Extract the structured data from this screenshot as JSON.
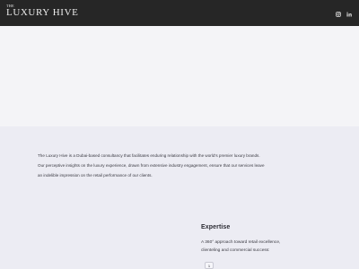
{
  "header": {
    "logo_the": "THE",
    "logo_main": "Luxury Hive",
    "social": [
      {
        "icon": "instagram-icon"
      },
      {
        "icon": "linkedin-icon"
      }
    ]
  },
  "intro": {
    "line1": "The Luxury Hive is a Dubai-based consultancy that facilitates enduring relationship with the world’s premier luxury brands.",
    "line2": "Our perceptive insights on the luxury experience, drawn from extensive industry engagement, ensure that our services leave",
    "line3": "an indelible impression on the retail performance of our clients."
  },
  "expertise": {
    "title": "Expertise",
    "desc_line1": "A 360° approach toward retail excellence,",
    "desc_line2": "clienteling and commercial success:",
    "step": "1"
  },
  "colors": {
    "header_bg": "#262626",
    "page_bg": "#f1f1f5",
    "band_bg": "#ececf3"
  }
}
